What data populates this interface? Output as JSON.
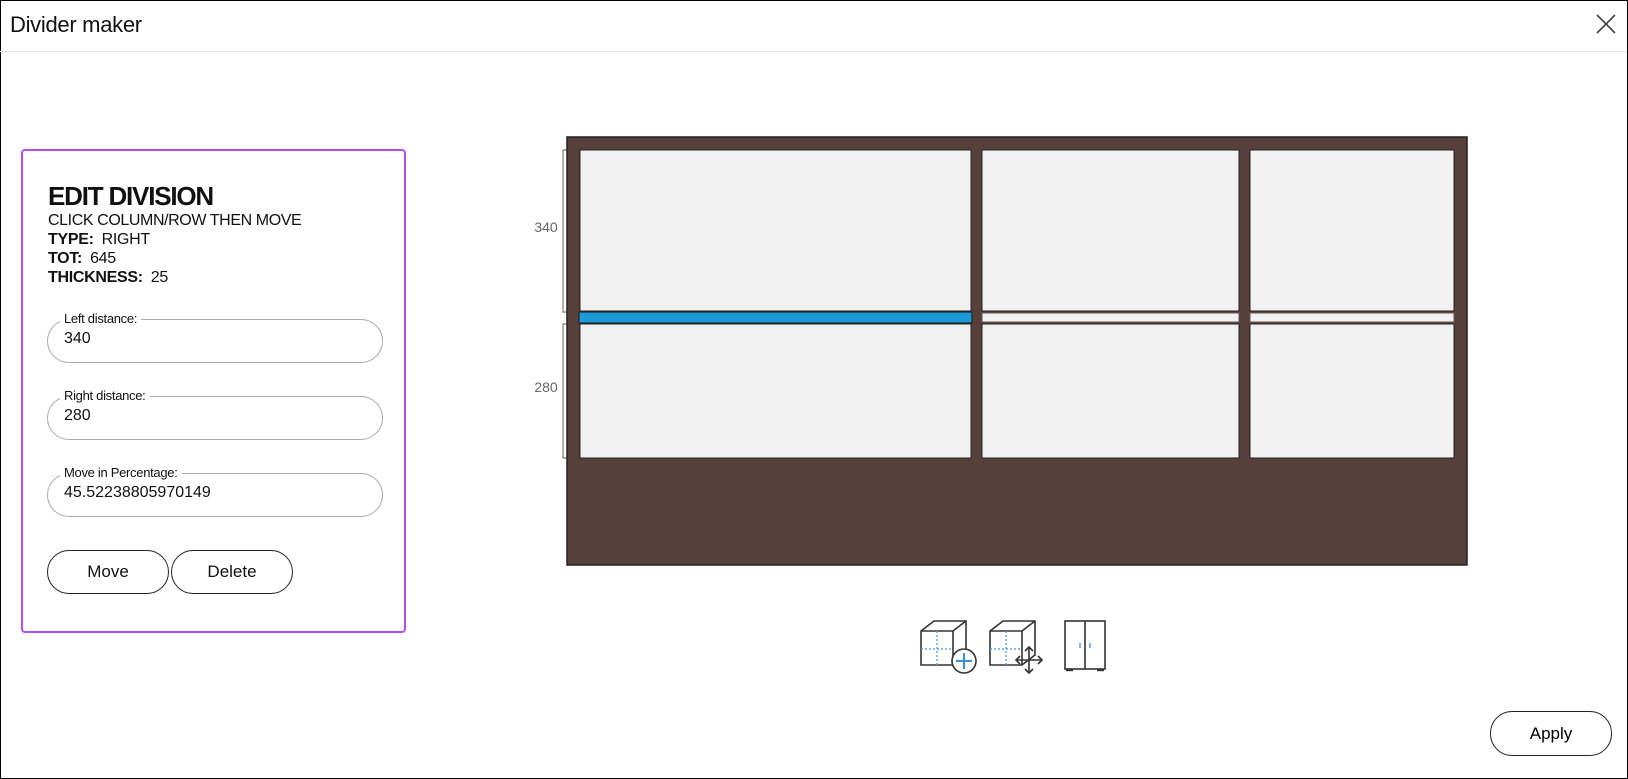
{
  "window": {
    "title": "Divider maker"
  },
  "panel": {
    "title": "EDIT DIVISION",
    "subtitle": "CLICK COLUMN/ROW THEN MOVE",
    "type_label": "TYPE:",
    "type_value": "RIGHT",
    "tot_label": "TOT:",
    "tot_value": "645",
    "thickness_label": "THICKNESS:",
    "thickness_value": "25",
    "left_distance": {
      "label": "Left distance:",
      "value": "340"
    },
    "right_distance": {
      "label": "Right distance:",
      "value": "280"
    },
    "percentage": {
      "label": "Move in Percentage:",
      "value": "45.52238805970149"
    },
    "move_label": "Move",
    "delete_label": "Delete"
  },
  "canvas": {
    "dimension_top": "340",
    "dimension_bottom": "280",
    "frame_color": "#574039",
    "panel_color": "#f1f1f1",
    "selected_color": "#1a9ad6"
  },
  "tools": [
    {
      "icon": "add-division-icon"
    },
    {
      "icon": "move-division-icon"
    },
    {
      "icon": "doors-icon"
    }
  ],
  "footer": {
    "apply_label": "Apply"
  }
}
